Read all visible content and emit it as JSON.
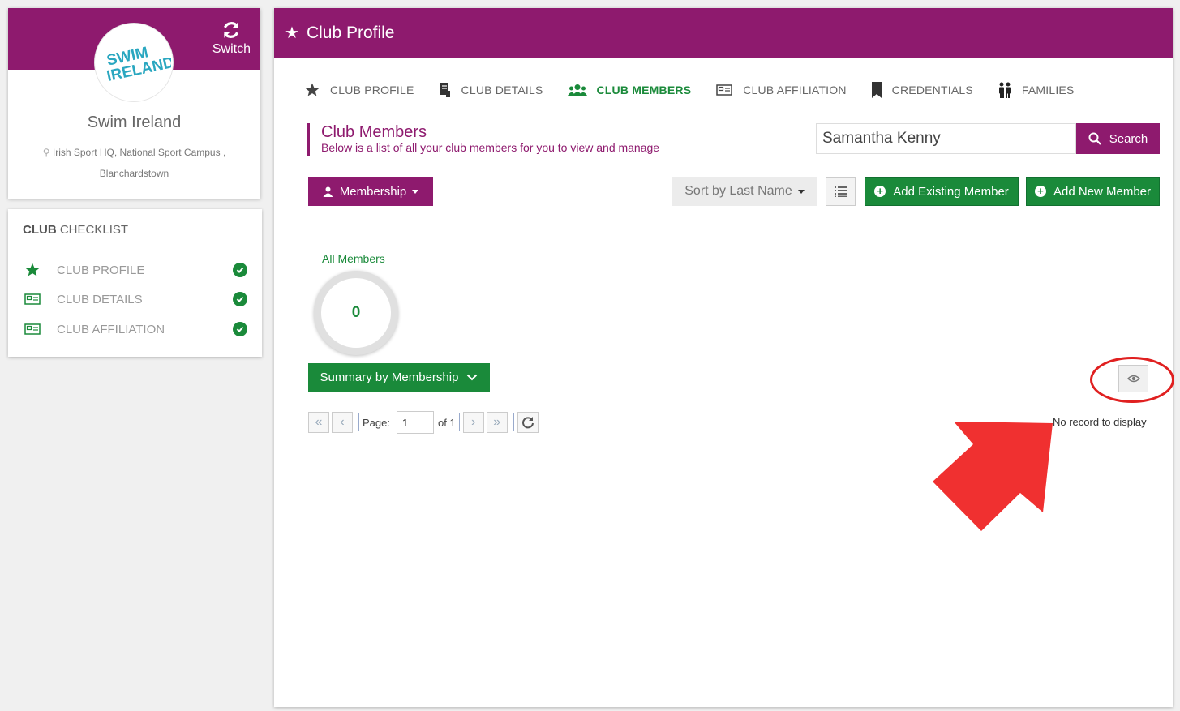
{
  "club": {
    "switch_label": "Switch",
    "logo_text_1": "SWIM",
    "logo_text_2": "IRELAND",
    "name": "Swim Ireland",
    "address": "Irish Sport HQ, National Sport Campus , Blanchardstown"
  },
  "checklist": {
    "title_bold": "CLUB",
    "title_rest": "CHECKLIST",
    "items": [
      {
        "label": "CLUB PROFILE",
        "icon": "star-icon"
      },
      {
        "label": "CLUB DETAILS",
        "icon": "id-card-icon"
      },
      {
        "label": "CLUB AFFILIATION",
        "icon": "id-card-icon"
      }
    ]
  },
  "header": {
    "title": "Club Profile"
  },
  "tabs": [
    {
      "label": "CLUB PROFILE",
      "icon": "star-icon"
    },
    {
      "label": "CLUB DETAILS",
      "icon": "document-icon"
    },
    {
      "label": "CLUB MEMBERS",
      "icon": "users-icon",
      "active": true
    },
    {
      "label": "CLUB AFFILIATION",
      "icon": "id-card-icon"
    },
    {
      "label": "CREDENTIALS",
      "icon": "bookmark-icon"
    },
    {
      "label": "FAMILIES",
      "icon": "family-icon"
    }
  ],
  "section": {
    "title": "Club Members",
    "subtitle": "Below is a list of all your club members for you to view and manage"
  },
  "search": {
    "value": "Samantha Kenny",
    "button_label": "Search"
  },
  "toolbar": {
    "membership_label": "Membership",
    "sort_label": "Sort by Last Name",
    "add_existing_label": "Add Existing Member",
    "add_new_label": "Add New Member"
  },
  "summary": {
    "all_members_label": "All Members",
    "count": "0",
    "summary_button_label": "Summary by Membership"
  },
  "pager": {
    "page_label": "Page:",
    "page_value": "1",
    "of_label": "of 1"
  },
  "empty_message": "No record to display",
  "colors": {
    "brand": "#8e1a6e",
    "accent": "#1a8a3a",
    "annotation": "#e02020"
  }
}
